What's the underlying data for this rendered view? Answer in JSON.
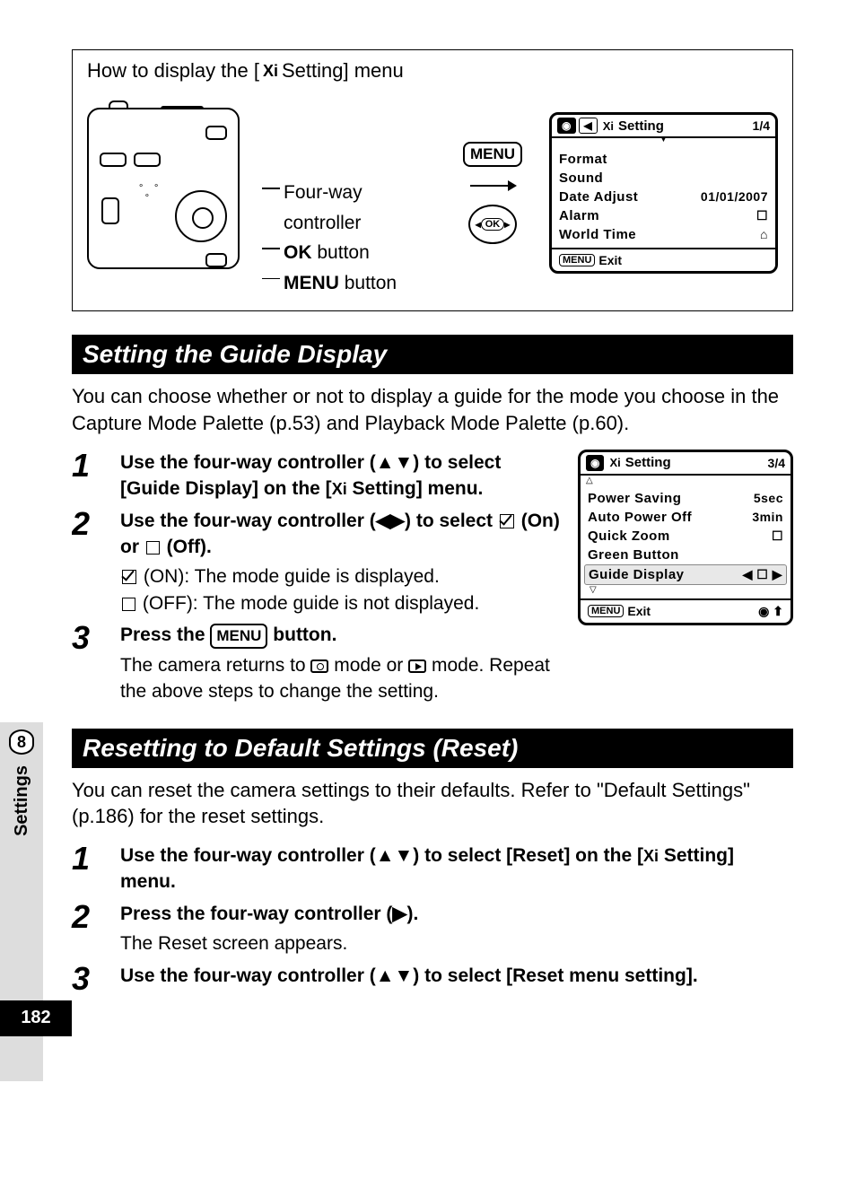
{
  "howto": {
    "title_pre": "How to display the [",
    "title_post": " Setting] menu",
    "labels": {
      "fourway": "Four-way controller",
      "ok": "OK",
      "ok_suffix": " button",
      "menu_bold": "MENU",
      "menu_suffix": " button"
    },
    "menu_button": "MENU",
    "ok_inner": "OK"
  },
  "lcd1": {
    "tab_left": "◀",
    "title": "Setting",
    "page": "1/4",
    "items": [
      {
        "label": "Format",
        "val": ""
      },
      {
        "label": "Sound",
        "val": ""
      },
      {
        "label": "Date Adjust",
        "val": "01/01/2007"
      },
      {
        "label": "Alarm",
        "val": "☐"
      },
      {
        "label": "World Time",
        "val": "⌂"
      }
    ],
    "exit": "Exit"
  },
  "section1": {
    "title": "Setting the Guide Display",
    "intro": "You can choose whether or not to display a guide for the mode you choose in the Capture Mode Palette (p.53) and Playback Mode Palette (p.60).",
    "step1": "Use the four-way controller (▲▼) to select [Guide Display] on the [",
    "step1b": " Setting] menu.",
    "step2": "Use the four-way controller (◀▶) to select ",
    "step2_on": " (On) or ",
    "step2_off": " (Off).",
    "desc_on": " (ON): The mode guide is displayed.",
    "desc_off": " (OFF): The mode guide is not displayed.",
    "step3": "Press the ",
    "step3_menu": "MENU",
    "step3b": " button.",
    "step3_desc_a": "The camera returns to ",
    "step3_desc_b": " mode or ",
    "step3_desc_c": " mode. Repeat the above steps to change the setting."
  },
  "lcd2": {
    "title": "Setting",
    "page": "3/4",
    "items": [
      {
        "label": "Power Saving",
        "val": "5sec"
      },
      {
        "label": "Auto Power Off",
        "val": "3min"
      },
      {
        "label": "Quick Zoom",
        "val": "☐"
      },
      {
        "label": "Green Button",
        "val": ""
      },
      {
        "label": "Guide Display",
        "val": "◀ ☐        ▶",
        "sel": true
      }
    ],
    "exit": "Exit"
  },
  "section2": {
    "title": "Resetting to Default Settings (Reset)",
    "intro": "You can reset the camera settings to their defaults. Refer to \"Default Settings\" (p.186) for the reset settings.",
    "step1a": "Use the four-way controller (▲▼) to select [Reset] on the [",
    "step1b": " Setting] menu.",
    "step2": "Press the four-way controller (▶).",
    "step2_desc": "The Reset screen appears.",
    "step3": "Use the four-way controller (▲▼) to select [Reset menu setting]."
  },
  "sidebar": {
    "chapter": "8",
    "label": "Settings"
  },
  "page_number": "182",
  "tool_glyph": "Xi"
}
